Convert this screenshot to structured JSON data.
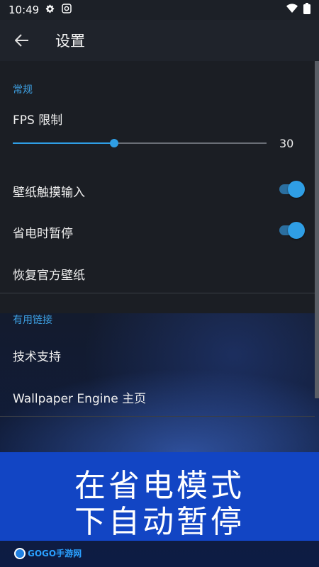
{
  "status_bar": {
    "time": "10:49"
  },
  "app_bar": {
    "title": "设置"
  },
  "sections": {
    "general": {
      "header": "常规",
      "fps_label": "FPS 限制",
      "fps_value": "30",
      "fps_level": 0.4,
      "touch_input_label": "壁纸触摸输入",
      "touch_input_on": true,
      "power_pause_label": "省电时暂停",
      "power_pause_on": true,
      "restore_label": "恢复官方壁纸"
    },
    "links": {
      "header": "有用链接",
      "support_label": "技术支持",
      "homepage_label": "Wallpaper Engine 主页"
    }
  },
  "banner": {
    "line1": "在省电模式",
    "line2": "下自动暂停"
  },
  "watermark": {
    "text": "GOGO手游网"
  },
  "colors": {
    "accent": "#2f9ee5",
    "banner": "#1245c4"
  }
}
